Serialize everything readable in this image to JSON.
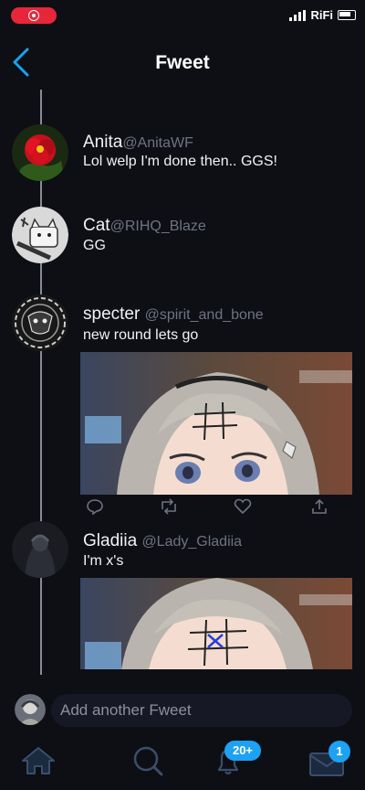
{
  "status_bar": {
    "carrier": "RiFi"
  },
  "header": {
    "title": "Fweet"
  },
  "tweets": [
    {
      "name": "Anita",
      "handle": "@AnitaWF",
      "text": "Lol welp I'm done then.. GGS!"
    },
    {
      "name": "Cat",
      "handle": "@RIHQ_Blaze",
      "text": "GG"
    },
    {
      "name": "specter",
      "handle": "@spirit_and_bone",
      "text": "new round lets go"
    },
    {
      "name": "Gladiia",
      "handle": "@Lady_Gladiia",
      "text": "I'm x's"
    }
  ],
  "compose": {
    "placeholder": "Add another Fweet"
  },
  "tabbar": {
    "notifications_badge": "20+",
    "messages_badge": "1"
  },
  "colors": {
    "accent": "#1da1f2",
    "background": "#0d0f15",
    "record": "#e8263a"
  }
}
